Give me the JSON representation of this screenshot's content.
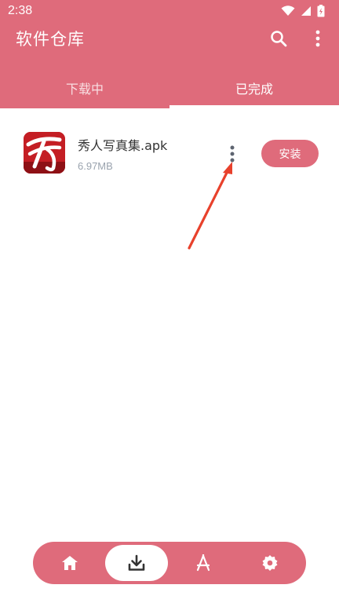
{
  "status_bar": {
    "time": "2:38"
  },
  "app_bar": {
    "title": "软件仓库"
  },
  "tabs": [
    {
      "label": "下载中",
      "selected": false
    },
    {
      "label": "已完成",
      "selected": true
    }
  ],
  "download_item": {
    "file_name": "秀人写真集.apk",
    "file_size": "6.97MB",
    "install_label": "安装"
  },
  "bottom_nav": {
    "items": [
      {
        "icon": "home-icon",
        "active": false
      },
      {
        "icon": "download-icon",
        "active": true
      },
      {
        "icon": "app-store-icon",
        "active": false
      },
      {
        "icon": "settings-icon",
        "active": false
      }
    ]
  },
  "colors": {
    "accent": "#df6b7b",
    "annotation_arrow": "#e8412c"
  }
}
